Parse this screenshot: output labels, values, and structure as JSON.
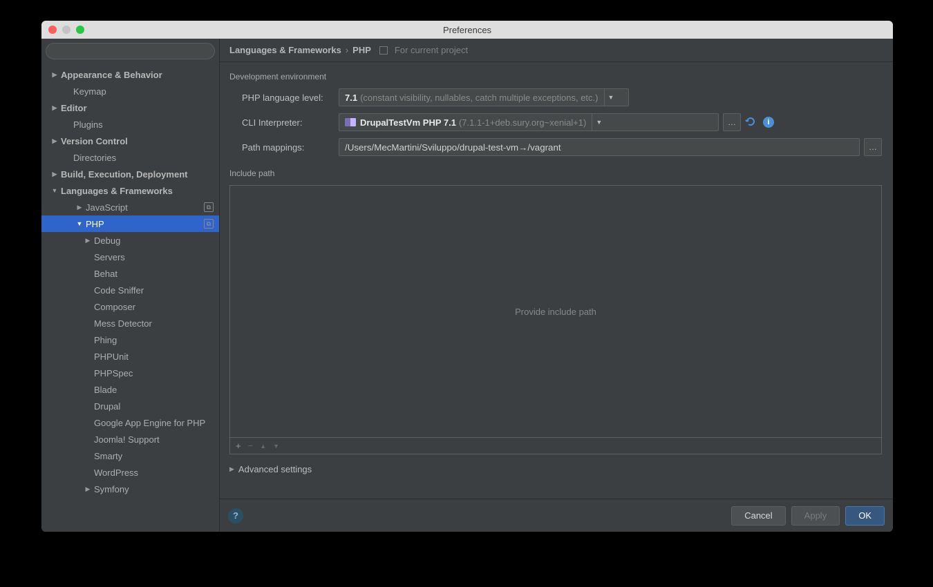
{
  "window": {
    "title": "Preferences"
  },
  "breadcrumb": {
    "root": "Languages & Frameworks",
    "leaf": "PHP",
    "scope_label": "For current project"
  },
  "search": {
    "placeholder": ""
  },
  "sidebar": {
    "items": [
      {
        "label": "Appearance & Behavior",
        "arrow": "▶",
        "indent": 0
      },
      {
        "label": "Keymap",
        "arrow": "",
        "indent": 1,
        "sub": true
      },
      {
        "label": "Editor",
        "arrow": "▶",
        "indent": 0
      },
      {
        "label": "Plugins",
        "arrow": "",
        "indent": 1,
        "sub": true
      },
      {
        "label": "Version Control",
        "arrow": "▶",
        "indent": 0
      },
      {
        "label": "Directories",
        "arrow": "",
        "indent": 1,
        "sub": true
      },
      {
        "label": "Build, Execution, Deployment",
        "arrow": "▶",
        "indent": 0
      },
      {
        "label": "Languages & Frameworks",
        "arrow": "▼",
        "indent": 0
      },
      {
        "label": "JavaScript",
        "arrow": "▶",
        "indent": 2,
        "sub": true,
        "badge": true
      },
      {
        "label": "PHP",
        "arrow": "▼",
        "indent": 2,
        "sub": true,
        "badge": true,
        "selected": true
      },
      {
        "label": "Debug",
        "arrow": "▶",
        "indent": 3,
        "sub": true
      },
      {
        "label": "Servers",
        "arrow": "",
        "indent": 3,
        "sub": true
      },
      {
        "label": "Behat",
        "arrow": "",
        "indent": 3,
        "sub": true
      },
      {
        "label": "Code Sniffer",
        "arrow": "",
        "indent": 3,
        "sub": true
      },
      {
        "label": "Composer",
        "arrow": "",
        "indent": 3,
        "sub": true
      },
      {
        "label": "Mess Detector",
        "arrow": "",
        "indent": 3,
        "sub": true
      },
      {
        "label": "Phing",
        "arrow": "",
        "indent": 3,
        "sub": true
      },
      {
        "label": "PHPUnit",
        "arrow": "",
        "indent": 3,
        "sub": true
      },
      {
        "label": "PHPSpec",
        "arrow": "",
        "indent": 3,
        "sub": true
      },
      {
        "label": "Blade",
        "arrow": "",
        "indent": 3,
        "sub": true
      },
      {
        "label": "Drupal",
        "arrow": "",
        "indent": 3,
        "sub": true
      },
      {
        "label": "Google App Engine for PHP",
        "arrow": "",
        "indent": 3,
        "sub": true
      },
      {
        "label": "Joomla! Support",
        "arrow": "",
        "indent": 3,
        "sub": true
      },
      {
        "label": "Smarty",
        "arrow": "",
        "indent": 3,
        "sub": true
      },
      {
        "label": "WordPress",
        "arrow": "",
        "indent": 3,
        "sub": true
      },
      {
        "label": "Symfony",
        "arrow": "▶",
        "indent": 3,
        "sub": true
      }
    ]
  },
  "dev_env": {
    "section_label": "Development environment",
    "lang_level_label": "PHP language level:",
    "lang_level_value": "7.1",
    "lang_level_hint": "(constant visibility, nullables, catch multiple exceptions, etc.)",
    "cli_label": "CLI Interpreter:",
    "cli_value": "DrupalTestVm PHP 7.1",
    "cli_hint": "(7.1.1-1+deb.sury.org~xenial+1)",
    "path_label": "Path mappings:",
    "path_value": "/Users/MecMartini/Sviluppo/drupal-test-vm→/vagrant"
  },
  "include": {
    "section_label": "Include path",
    "placeholder": "Provide include path",
    "toolbar": {
      "add": "+",
      "remove": "−",
      "up": "▲",
      "down": "▼"
    }
  },
  "advanced": {
    "label": "Advanced settings"
  },
  "footer": {
    "cancel": "Cancel",
    "apply": "Apply",
    "ok": "OK"
  }
}
